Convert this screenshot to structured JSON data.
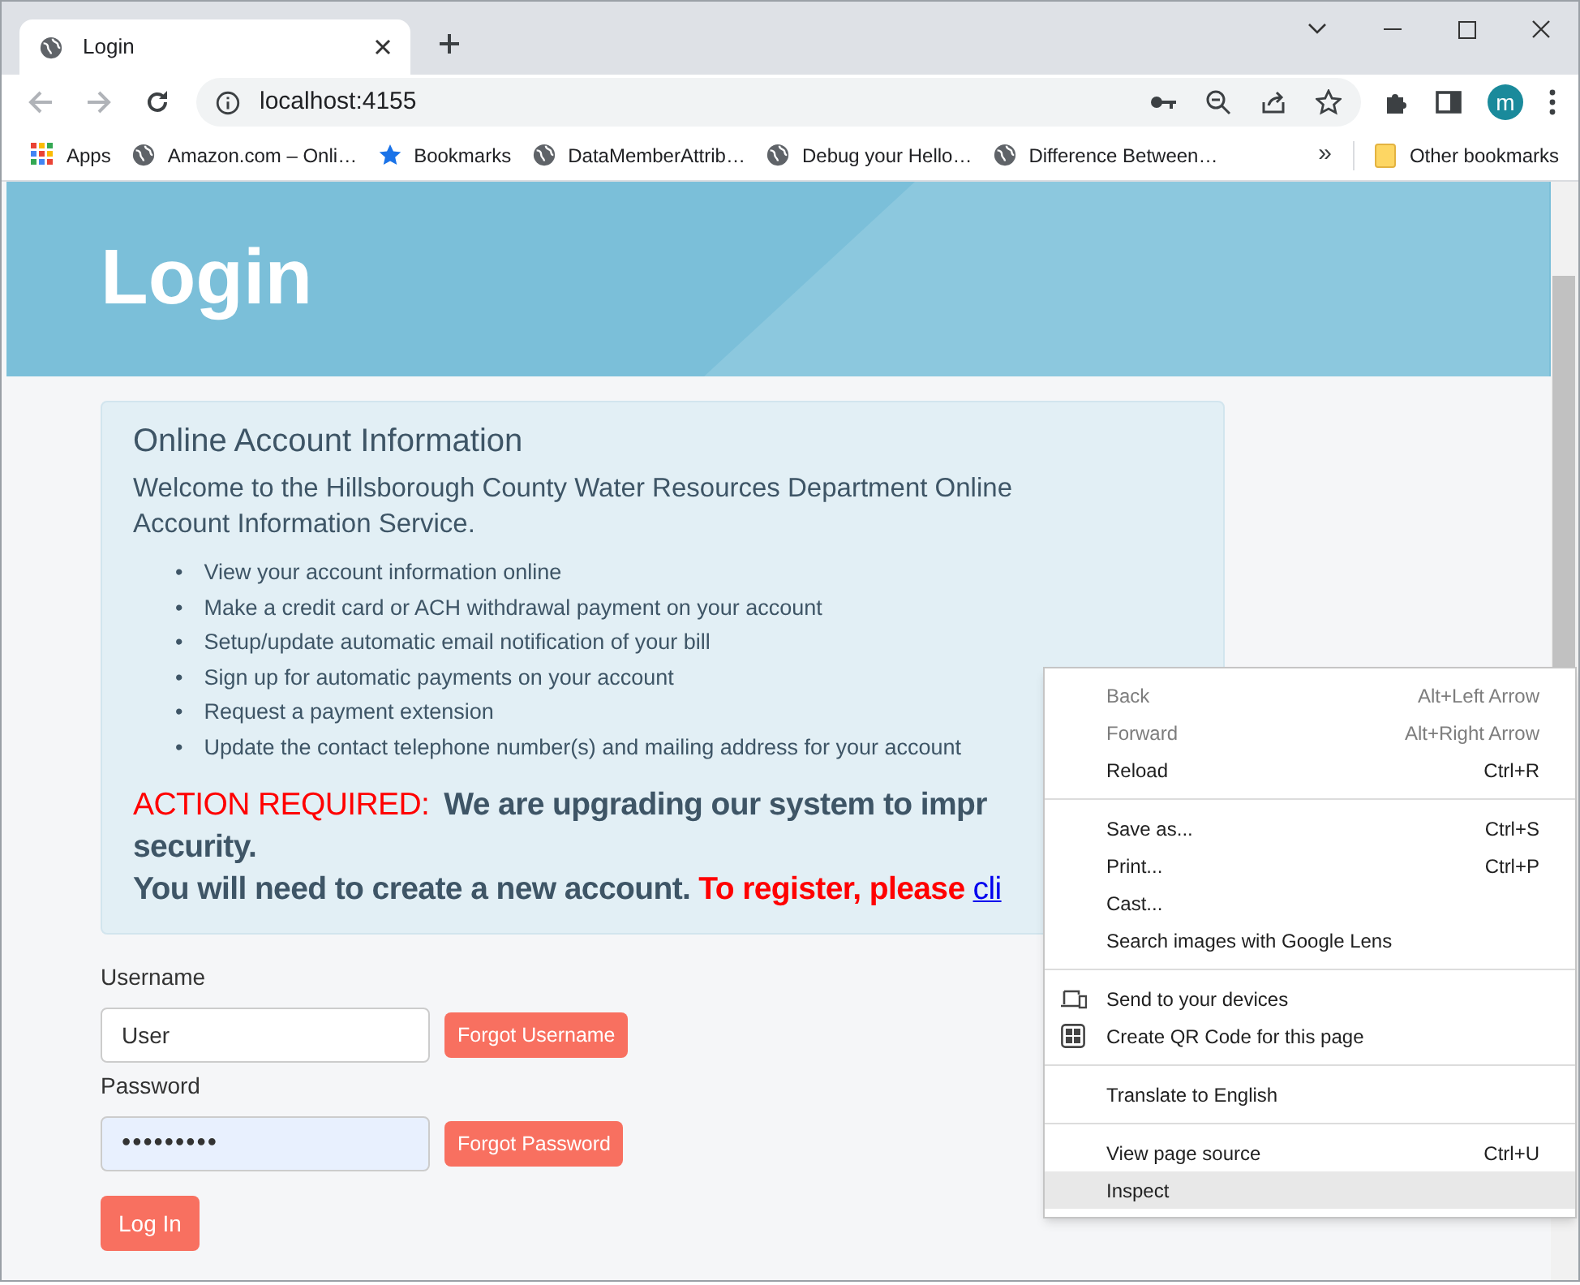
{
  "browser": {
    "tab": {
      "title": "Login",
      "selected": true
    },
    "address": "localhost:4155",
    "avatar": "m",
    "bookmarks": [
      {
        "label": "Apps",
        "kind": "apps"
      },
      {
        "label": "Amazon.com – Onli…",
        "kind": "globe"
      },
      {
        "label": "Bookmarks",
        "kind": "star"
      },
      {
        "label": "DataMemberAttrib…",
        "kind": "globe"
      },
      {
        "label": "Debug your Hello…",
        "kind": "globe"
      },
      {
        "label": "Difference Between…",
        "kind": "globe"
      }
    ],
    "overflow": "»",
    "other_bookmarks": "Other bookmarks"
  },
  "page": {
    "heading": "Login",
    "info": {
      "title": "Online Account Information",
      "welcome": "Welcome to the Hillsborough County Water Resources Department Online Account Information Service.",
      "marker": "•",
      "bullets": [
        "View your account information online",
        "Make a credit card or ACH withdrawal payment on your account",
        "Setup/update automatic email notification of your bill",
        "Sign up for automatic payments on your account",
        "Request a payment extension",
        "Update the contact telephone number(s) and mailing address for your account"
      ],
      "action_label": "ACTION REQUIRED:",
      "action_text": "We are upgrading our system to impr",
      "action_text_2": "security.",
      "notice": "You will need to create a new account.",
      "register": "To register, please",
      "link": "cli"
    },
    "form": {
      "username_label": "Username",
      "username_value": "User",
      "forgot_username": "Forgot Username",
      "password_label": "Password",
      "password_value": "•••••••••",
      "password_autofilled": true,
      "forgot_password": "Forgot Password",
      "login": "Log In"
    }
  },
  "context_menu": {
    "groups": [
      [
        {
          "label": "Back",
          "shortcut": "Alt+Left Arrow",
          "disabled": true,
          "selected": false,
          "kind": "plain"
        },
        {
          "label": "Forward",
          "shortcut": "Alt+Right Arrow",
          "disabled": true,
          "selected": false,
          "kind": "plain"
        },
        {
          "label": "Reload",
          "shortcut": "Ctrl+R",
          "disabled": false,
          "selected": false,
          "kind": "plain"
        }
      ],
      [
        {
          "label": "Save as...",
          "shortcut": "Ctrl+S",
          "disabled": false,
          "selected": false,
          "kind": "plain"
        },
        {
          "label": "Print...",
          "shortcut": "Ctrl+P",
          "disabled": false,
          "selected": false,
          "kind": "plain"
        },
        {
          "label": "Cast...",
          "disabled": false,
          "selected": false,
          "kind": "plain"
        },
        {
          "label": "Search images with Google Lens",
          "disabled": false,
          "selected": false,
          "kind": "plain"
        }
      ],
      [
        {
          "label": "Send to your devices",
          "disabled": false,
          "selected": false,
          "kind": "devices"
        },
        {
          "label": "Create QR Code for this page",
          "disabled": false,
          "selected": false,
          "kind": "qr"
        }
      ],
      [
        {
          "label": "Translate to English",
          "disabled": false,
          "selected": false,
          "kind": "plain"
        }
      ],
      [
        {
          "label": "View page source",
          "shortcut": "Ctrl+U",
          "disabled": false,
          "selected": false,
          "kind": "plain"
        },
        {
          "label": "Inspect",
          "disabled": false,
          "selected": true,
          "kind": "plain"
        }
      ]
    ]
  }
}
